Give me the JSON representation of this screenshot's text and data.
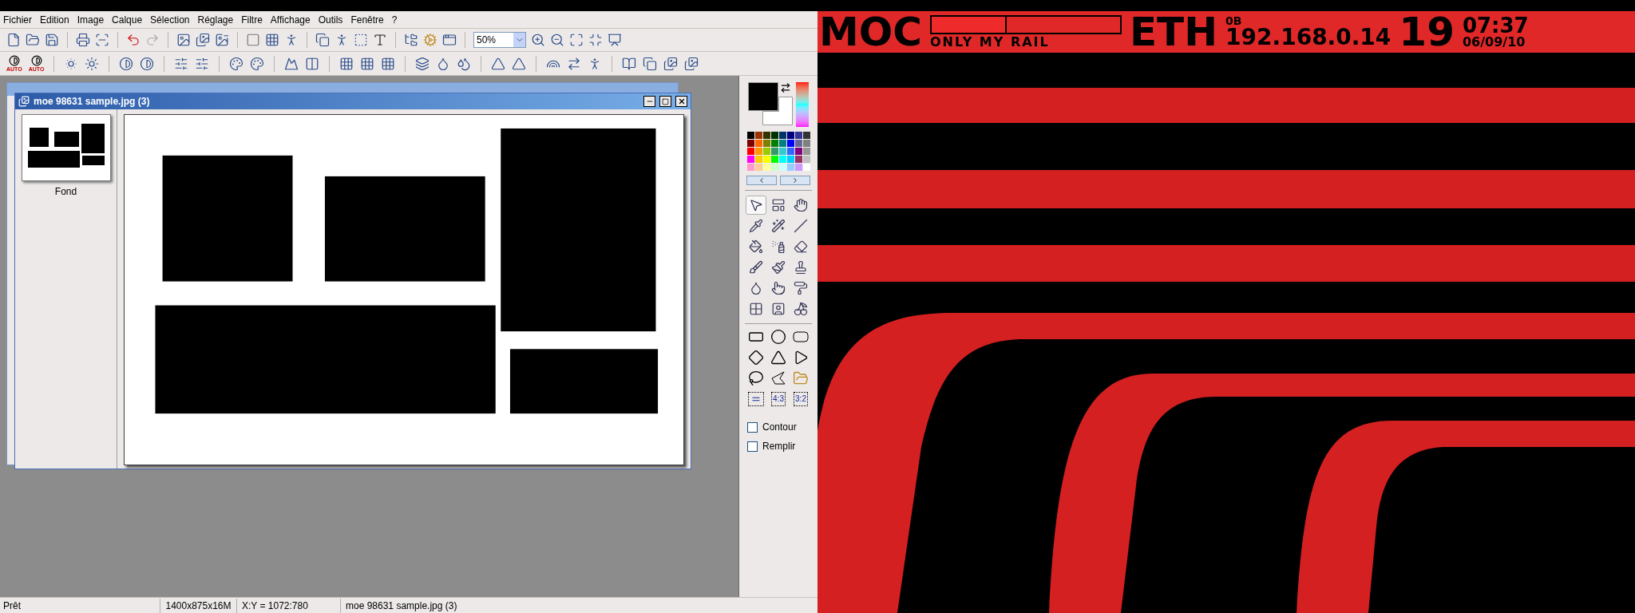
{
  "menu": [
    "Fichier",
    "Edition",
    "Image",
    "Calque",
    "Sélection",
    "Réglage",
    "Filtre",
    "Affichage",
    "Outils",
    "Fenêtre",
    "?"
  ],
  "zoom_combo": {
    "value": "50%"
  },
  "toolbar2": {
    "auto_labels": [
      "AUTO",
      "AUTO"
    ]
  },
  "document_window": {
    "title": "moe 98631 sample.jpg (3)",
    "layers": [
      {
        "name": "Fond",
        "selected": true
      }
    ]
  },
  "palette": {
    "swatches": [
      {
        "color": "#000000"
      },
      {
        "color": "#993300"
      },
      {
        "color": "#333300"
      },
      {
        "color": "#003300"
      },
      {
        "color": "#003366"
      },
      {
        "color": "#000080"
      },
      {
        "color": "#333399"
      },
      {
        "color": "#333333"
      },
      {
        "color": "#800000"
      },
      {
        "color": "#ff6600"
      },
      {
        "color": "#808000"
      },
      {
        "color": "#008000"
      },
      {
        "color": "#008080"
      },
      {
        "color": "#0000ff"
      },
      {
        "color": "#666699"
      },
      {
        "color": "#808080"
      },
      {
        "color": "#ff0000"
      },
      {
        "color": "#ff9900"
      },
      {
        "color": "#99cc00"
      },
      {
        "color": "#339966"
      },
      {
        "color": "#33cccc"
      },
      {
        "color": "#3366ff"
      },
      {
        "color": "#800080"
      },
      {
        "color": "#969696"
      },
      {
        "color": "#ff00ff"
      },
      {
        "color": "#ffcc00"
      },
      {
        "color": "#ffff00"
      },
      {
        "color": "#00ff00"
      },
      {
        "color": "#00ffff"
      },
      {
        "color": "#00ccff"
      },
      {
        "color": "#993366"
      },
      {
        "color": "#c0c0c0"
      },
      {
        "color": "#ff99cc"
      },
      {
        "color": "#ffcc99"
      },
      {
        "color": "#ffff99"
      },
      {
        "color": "#ccffcc"
      },
      {
        "color": "#ccffff"
      },
      {
        "color": "#99ccff"
      },
      {
        "color": "#cc99ff"
      },
      {
        "color": "#ffffff"
      }
    ]
  },
  "tools": [
    {
      "selected": true
    },
    {
      "selected": false
    },
    {
      "selected": false
    },
    {
      "selected": false
    },
    {
      "selected": false
    },
    {
      "selected": false
    },
    {
      "selected": false
    },
    {
      "selected": false
    },
    {
      "selected": false
    },
    {
      "selected": false
    },
    {
      "selected": false
    },
    {
      "selected": false
    },
    {
      "selected": false
    },
    {
      "selected": false
    },
    {
      "selected": false
    },
    {
      "selected": false
    },
    {
      "selected": false
    },
    {
      "selected": false
    }
  ],
  "shape_tools": [
    {
      "kind": "rectangle"
    },
    {
      "kind": "ellipse"
    },
    {
      "kind": "rounded-rectangle"
    },
    {
      "kind": "diamond"
    },
    {
      "kind": "triangle"
    },
    {
      "kind": "right-triangle"
    },
    {
      "kind": "lasso"
    },
    {
      "kind": "polygon"
    },
    {
      "kind": "open-folder"
    },
    {
      "kind": "equal"
    },
    {
      "kind": "ratio",
      "label": "4:3"
    },
    {
      "kind": "ratio",
      "label": "3:2"
    }
  ],
  "options": [
    {
      "label": "Contour",
      "checked": false
    },
    {
      "label": "Remplir",
      "checked": false
    }
  ],
  "status_bar": [
    "Prêt",
    "1400x875x16M",
    "X:Y = 1072:780",
    "moe 98631 sample.jpg (3)"
  ],
  "desktop_widget": {
    "progress": {
      "level": 0.4
    },
    "host": "MOC",
    "track": "ONLY MY RAIL",
    "network": "ETH",
    "unit": "0B",
    "ip": "192.168.0.14",
    "day": "19",
    "time": "07:37",
    "date": "06/09/10"
  }
}
